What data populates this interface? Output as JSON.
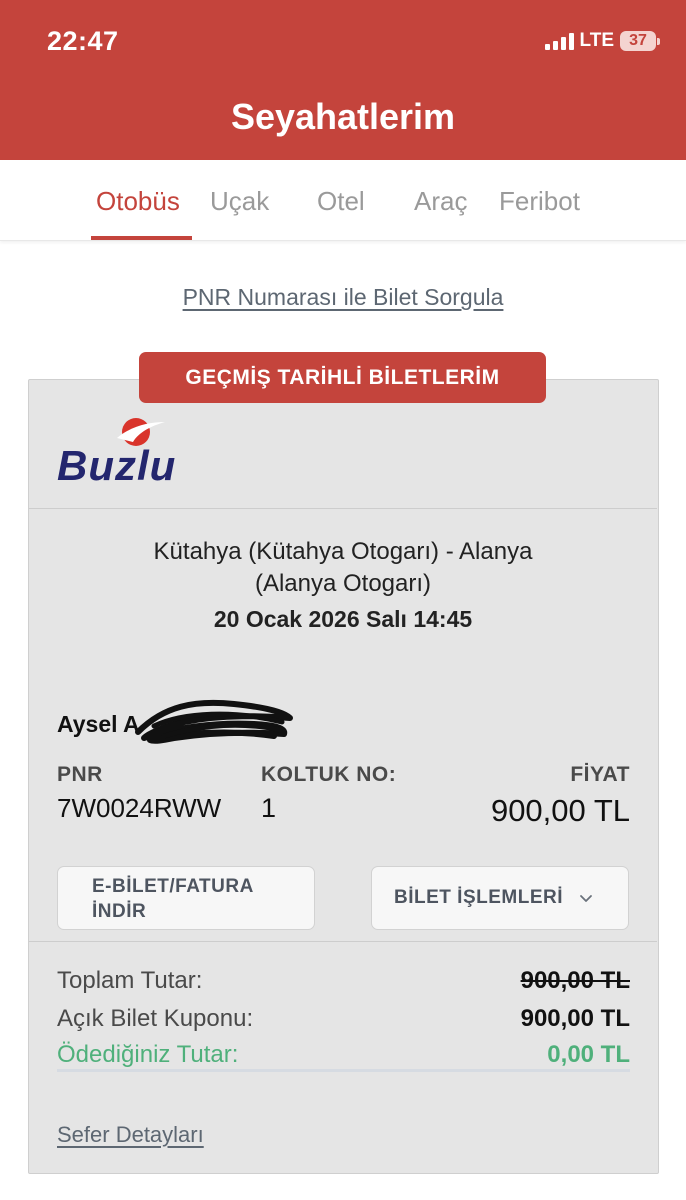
{
  "status_bar": {
    "time": "22:47",
    "network": "LTE",
    "battery": "37"
  },
  "header": {
    "title": "Seyahatlerim"
  },
  "tabs": [
    {
      "label": "Otobüs",
      "active": true
    },
    {
      "label": "Uçak",
      "active": false
    },
    {
      "label": "Otel",
      "active": false
    },
    {
      "label": "Araç",
      "active": false
    },
    {
      "label": "Feribot",
      "active": false
    }
  ],
  "pnr_query_link": "PNR Numarası ile Bilet Sorgula",
  "card": {
    "badge": "GEÇMİŞ TARİHLİ BİLETLERİM",
    "company": "Buzlu",
    "route_line1": "Kütahya (Kütahya Otogarı) - Alanya",
    "route_line2": "(Alanya Otogarı)",
    "date": "20 Ocak 2026 Salı 14:45",
    "passenger": "Aysel A",
    "pnr_label": "PNR",
    "pnr_value": "7W0024RWW",
    "seat_label": "KOLTUK NO:",
    "seat_value": "1",
    "price_label": "FİYAT",
    "price_value": "900,00 TL",
    "btn_ebilet_line1": "E-BİLET/FATURA",
    "btn_ebilet_line2": "İNDİR",
    "btn_islemler": "BİLET İŞLEMLERİ",
    "total_label": "Toplam Tutar:",
    "total_value": "900,00 TL",
    "coupon_label": "Açık Bilet Kuponu:",
    "coupon_value": "900,00 TL",
    "paid_label": "Ödediğiniz Tutar:",
    "paid_value": "0,00 TL",
    "details_link": "Sefer Detayları"
  },
  "colors": {
    "brand_red": "#c4443c",
    "paid_green": "#4fb07b",
    "logo_navy": "#23266e"
  },
  "icons": [
    "signal-icon",
    "battery-icon",
    "buzlu-logo-mark",
    "chevron-down-icon"
  ]
}
